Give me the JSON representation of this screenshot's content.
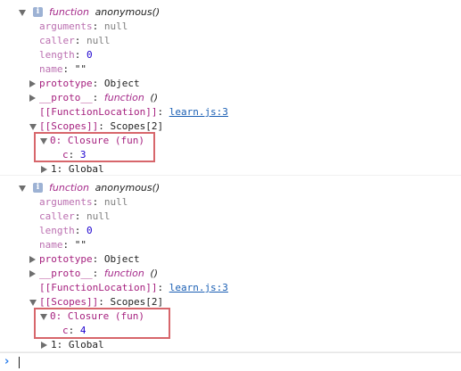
{
  "colors": {
    "highlight_box": "#d7666b",
    "keyword": "#a52a8a",
    "property": "#a6217f",
    "number": "#1c00cf",
    "link": "#1a5fb4",
    "prompt": "#2f80ed",
    "info_icon": "#9db2d4"
  },
  "icons": {
    "expand_open": "triangle-down-icon",
    "expand_closed": "triangle-right-icon",
    "info": "info-icon",
    "prompt": "chevron-right-icon"
  },
  "entries": [
    {
      "keyword": "function",
      "name": "anonymous()",
      "arguments_key": "arguments",
      "arguments_value": "null",
      "caller_key": "caller",
      "caller_value": "null",
      "length_key": "length",
      "length_value": "0",
      "name_key": "name",
      "name_value": "\"\"",
      "prototype_key": "prototype",
      "prototype_value": "Object",
      "proto_key": "__proto__",
      "proto_keyword": "function",
      "proto_value": "()",
      "location_key": "[[FunctionLocation]]",
      "location_link": "learn.js:3",
      "scopes_key": "[[Scopes]]",
      "scopes_value": "Scopes[2]",
      "closure_label": "0: Closure (fun)",
      "closure_var_key": "c",
      "closure_var_value": "3",
      "global_label": "1: Global"
    },
    {
      "keyword": "function",
      "name": "anonymous()",
      "arguments_key": "arguments",
      "arguments_value": "null",
      "caller_key": "caller",
      "caller_value": "null",
      "length_key": "length",
      "length_value": "0",
      "name_key": "name",
      "name_value": "\"\"",
      "prototype_key": "prototype",
      "prototype_value": "Object",
      "proto_key": "__proto__",
      "proto_keyword": "function",
      "proto_value": "()",
      "location_key": "[[FunctionLocation]]",
      "location_link": "learn.js:3",
      "scopes_key": "[[Scopes]]",
      "scopes_value": "Scopes[2]",
      "closure_label": "0: Closure (fun)",
      "closure_var_key": "c",
      "closure_var_value": "4",
      "global_label": "1: Global"
    }
  ]
}
